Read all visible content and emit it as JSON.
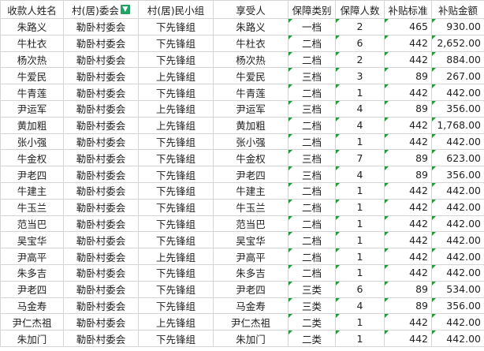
{
  "headers": [
    "收款人姓名",
    "村(居)委会",
    "村(居)民小组",
    "享受人",
    "保障类别",
    "保障人数",
    "补贴标准",
    "补贴金额"
  ],
  "filter_icon": "filter-icon",
  "rows": [
    [
      "朱路义",
      "勒卧村委会",
      "下先锋组",
      "朱路义",
      "一档",
      "2",
      "465",
      "930.00"
    ],
    [
      "牛杜衣",
      "勒卧村委会",
      "下先锋组",
      "牛杜衣",
      "二档",
      "6",
      "442",
      "2,652.00"
    ],
    [
      "杨次热",
      "勒卧村委会",
      "下先锋组",
      "杨次热",
      "二档",
      "2",
      "442",
      "884.00"
    ],
    [
      "牛爱民",
      "勒卧村委会",
      "上先锋组",
      "牛爱民",
      "三档",
      "3",
      "89",
      "267.00"
    ],
    [
      "牛青莲",
      "勒卧村委会",
      "下先锋组",
      "牛青莲",
      "二档",
      "1",
      "442",
      "442.00"
    ],
    [
      "尹运军",
      "勒卧村委会",
      "上先锋组",
      "尹运军",
      "三档",
      "4",
      "89",
      "356.00"
    ],
    [
      "黄加粗",
      "勒卧村委会",
      "上先锋组",
      "黄加粗",
      "二档",
      "4",
      "442",
      "1,768.00"
    ],
    [
      "张小强",
      "勒卧村委会",
      "下先锋组",
      "张小强",
      "二档",
      "1",
      "442",
      "442.00"
    ],
    [
      "牛金权",
      "勒卧村委会",
      "下先锋组",
      "牛金权",
      "三档",
      "7",
      "89",
      "623.00"
    ],
    [
      "尹老四",
      "勒卧村委会",
      "下先锋组",
      "尹老四",
      "三档",
      "4",
      "89",
      "356.00"
    ],
    [
      "牛建主",
      "勒卧村委会",
      "下先锋组",
      "牛建主",
      "二档",
      "1",
      "442",
      "442.00"
    ],
    [
      "牛玉兰",
      "勒卧村委会",
      "下先锋组",
      "牛玉兰",
      "二档",
      "1",
      "442",
      "442.00"
    ],
    [
      "范当巴",
      "勒卧村委会",
      "下先锋组",
      "范当巴",
      "二档",
      "1",
      "442",
      "442.00"
    ],
    [
      "吴宝华",
      "勒卧村委会",
      "下先锋组",
      "吴宝华",
      "二档",
      "1",
      "442",
      "442.00"
    ],
    [
      "尹高平",
      "勒卧村委会",
      "上先锋组",
      "尹高平",
      "二档",
      "1",
      "442",
      "442.00"
    ],
    [
      "朱多吉",
      "勒卧村委会",
      "下先锋组",
      "朱多吉",
      "二档",
      "1",
      "442",
      "442.00"
    ],
    [
      "尹老四",
      "勒卧村委会",
      "下先锋组",
      "尹老四",
      "三类",
      "6",
      "89",
      "534.00"
    ],
    [
      "马金寿",
      "勒卧村委会",
      "下先锋组",
      "马金寿",
      "三类",
      "4",
      "89",
      "356.00"
    ],
    [
      "尹仁杰祖",
      "勒卧村委会",
      "上先锋组",
      "尹仁杰祖",
      "二类",
      "1",
      "442",
      "442.00"
    ],
    [
      "朱加门",
      "勒卧村委会",
      "下先锋组",
      "朱加门",
      "二类",
      "1",
      "442",
      "442.00"
    ]
  ]
}
